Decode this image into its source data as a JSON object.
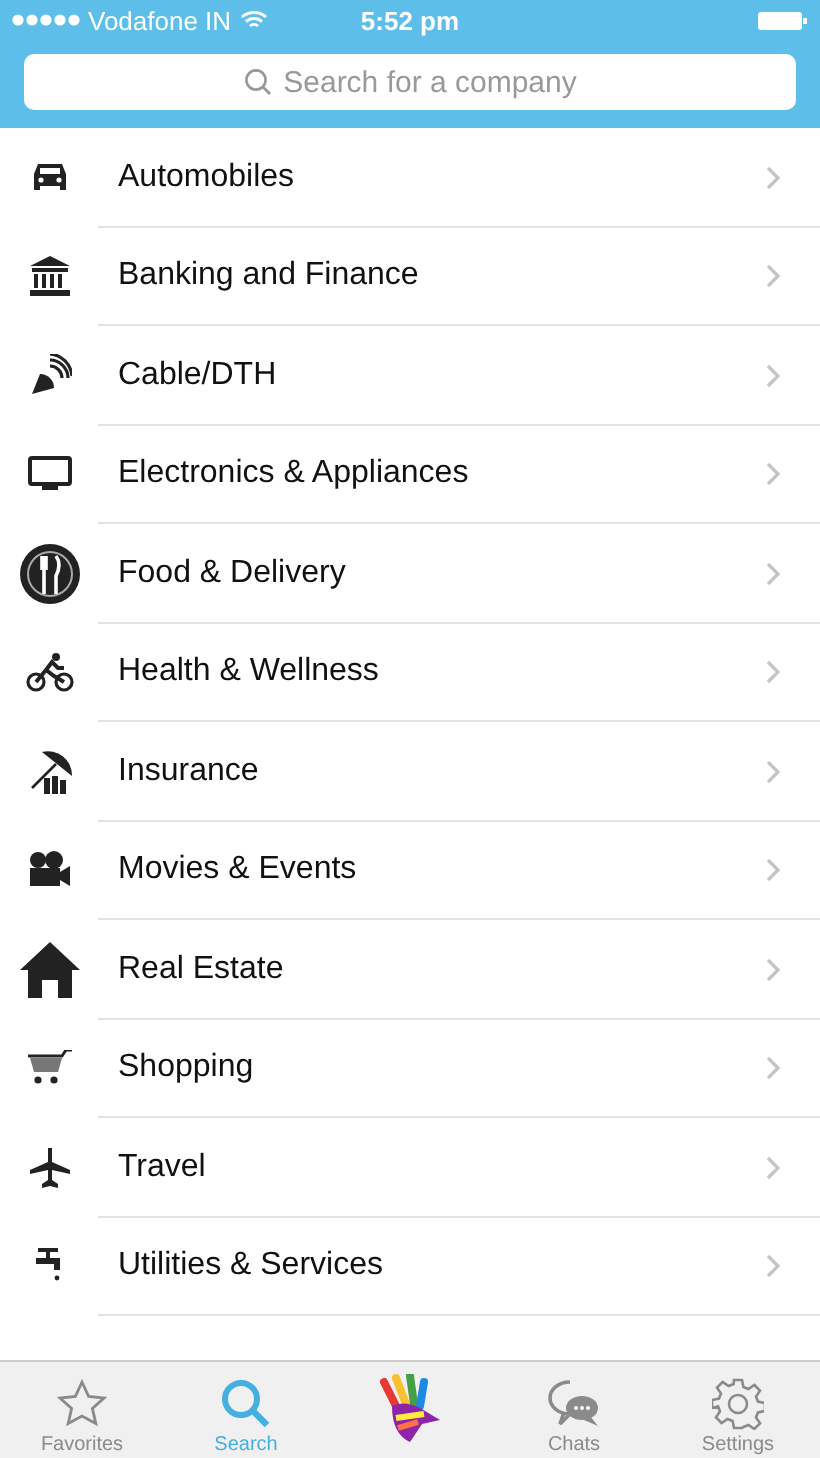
{
  "status_bar": {
    "carrier": "Vodafone IN",
    "time": "5:52 pm"
  },
  "search": {
    "placeholder": "Search for a company"
  },
  "categories": [
    {
      "label": "Automobiles"
    },
    {
      "label": "Banking and Finance"
    },
    {
      "label": "Cable/DTH"
    },
    {
      "label": "Electronics & Appliances"
    },
    {
      "label": "Food & Delivery"
    },
    {
      "label": "Health & Wellness"
    },
    {
      "label": "Insurance"
    },
    {
      "label": "Movies & Events"
    },
    {
      "label": "Real Estate"
    },
    {
      "label": "Shopping"
    },
    {
      "label": "Travel"
    },
    {
      "label": "Utilities & Services"
    }
  ],
  "tabs": [
    {
      "kind": "favorites",
      "label": "Favorites",
      "selected": false
    },
    {
      "kind": "search",
      "label": "Search",
      "selected": true
    },
    {
      "kind": "logo"
    },
    {
      "kind": "chats",
      "label": "Chats",
      "selected": false
    },
    {
      "kind": "settings",
      "label": "Settings",
      "selected": false
    }
  ]
}
